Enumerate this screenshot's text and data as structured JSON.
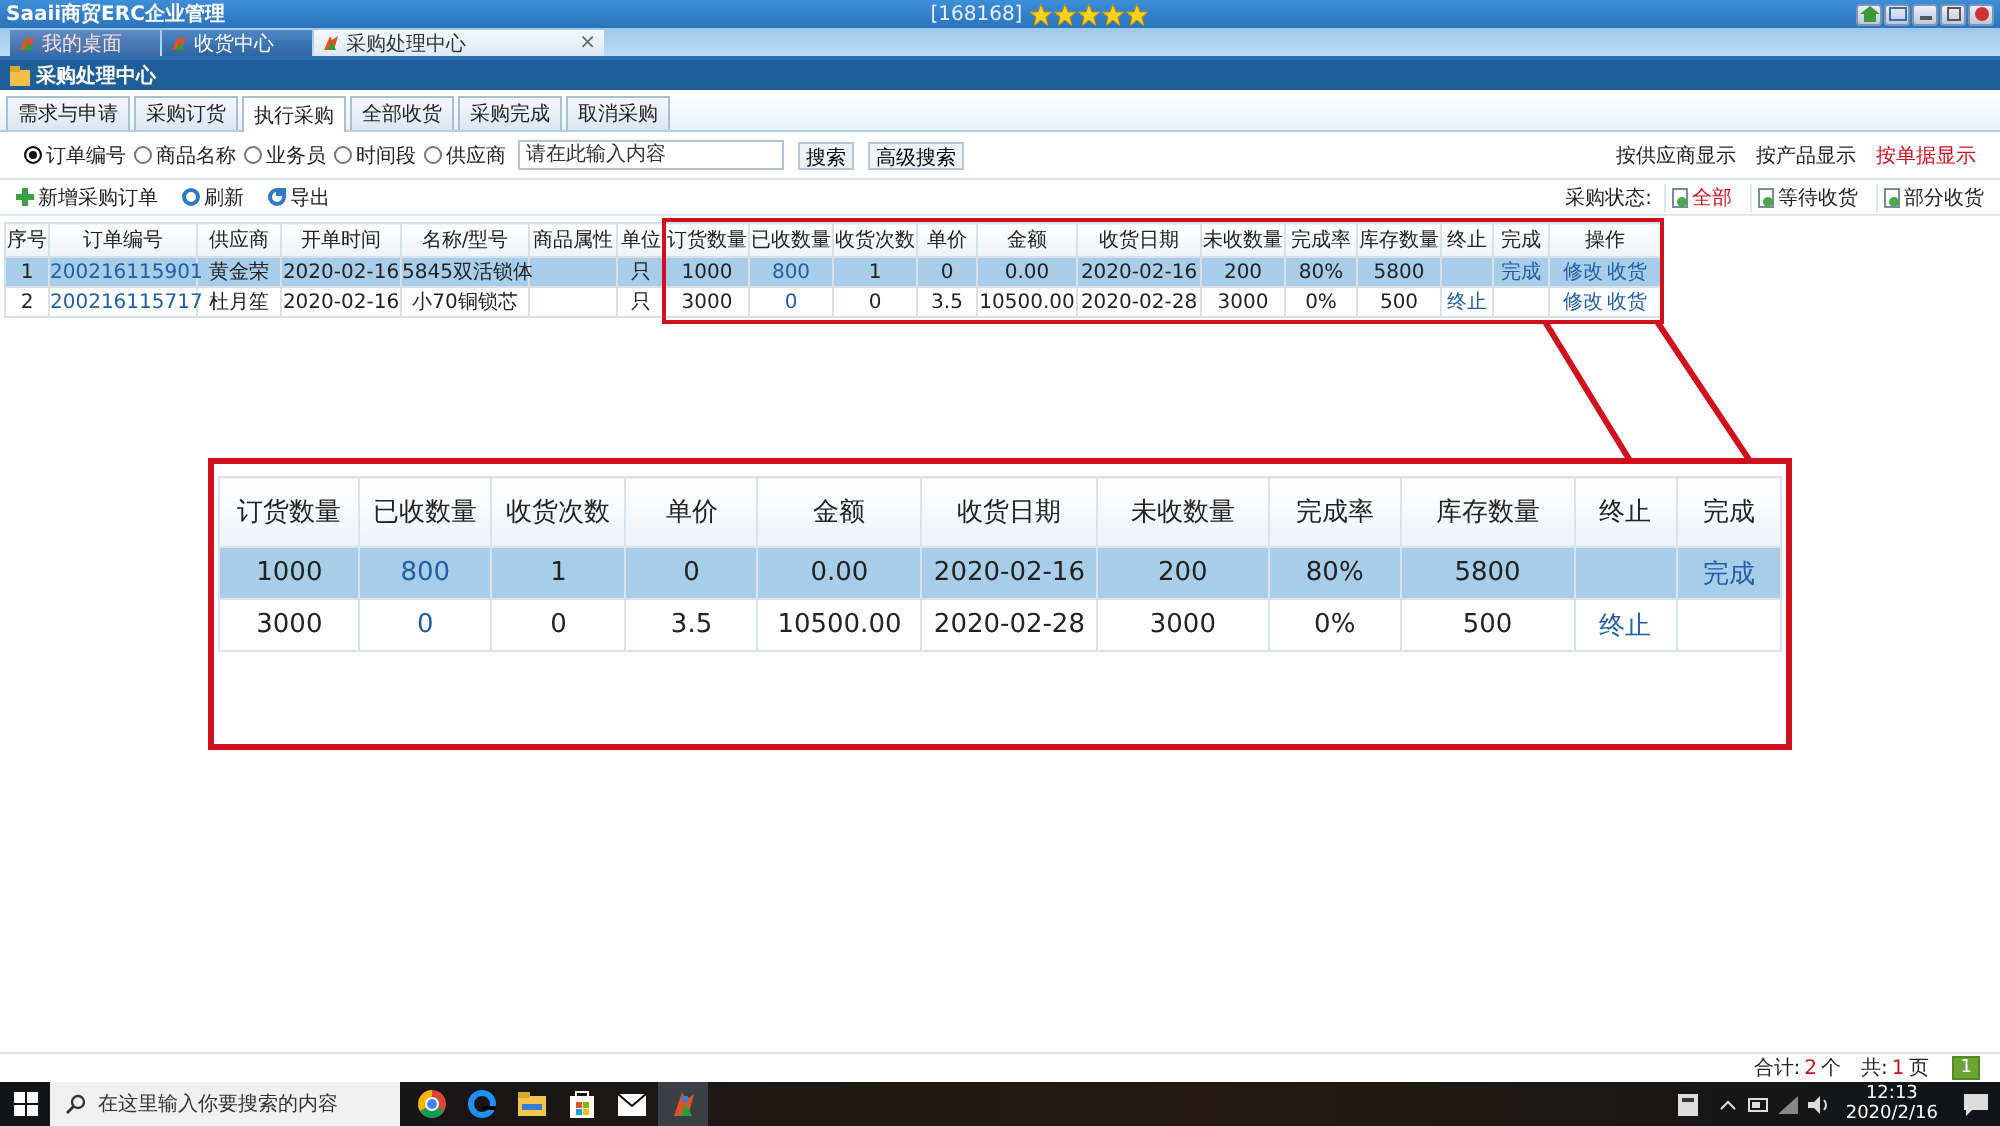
{
  "window": {
    "title": "Saaii商贸ERC企业管理",
    "user": "[168168]"
  },
  "doc_tabs": [
    {
      "label": "我的桌面",
      "selected": false,
      "kind": "home"
    },
    {
      "label": "收货中心",
      "selected": false,
      "kind": "page"
    },
    {
      "label": "采购处理中心",
      "selected": true,
      "kind": "page",
      "close": "×"
    }
  ],
  "page_title": "采购处理中心",
  "tabs": [
    {
      "label": "需求与申请",
      "selected": false
    },
    {
      "label": "采购订货",
      "selected": false
    },
    {
      "label": "执行采购",
      "selected": true
    },
    {
      "label": "全部收货",
      "selected": false
    },
    {
      "label": "采购完成",
      "selected": false
    },
    {
      "label": "取消采购",
      "selected": false
    }
  ],
  "search": {
    "options": [
      {
        "label": "订单编号",
        "selected": true
      },
      {
        "label": "商品名称",
        "selected": false
      },
      {
        "label": "业务员",
        "selected": false
      },
      {
        "label": "时间段",
        "selected": false
      },
      {
        "label": "供应商",
        "selected": false
      }
    ],
    "placeholder": "请在此输入内容",
    "buttons": [
      "搜索",
      "高级搜索"
    ]
  },
  "view_links": [
    {
      "label": "按供应商显示",
      "selected": false
    },
    {
      "label": "按产品显示",
      "selected": false
    },
    {
      "label": "按单据显示",
      "selected": true
    }
  ],
  "toolbar": [
    {
      "label": "新增采购订单",
      "kind": "add"
    },
    {
      "label": "刷新",
      "kind": "refresh"
    },
    {
      "label": "导出",
      "kind": "export"
    }
  ],
  "status_filter": {
    "label": "采购状态:",
    "options": [
      {
        "label": "全部",
        "selected": true
      },
      {
        "label": "等待收货",
        "selected": false
      },
      {
        "label": "部分收货",
        "selected": false
      }
    ]
  },
  "table": {
    "columns": [
      "序号",
      "订单编号",
      "供应商",
      "开单时间",
      "名称/型号",
      "商品属性",
      "单位",
      "订货数量",
      "已收数量",
      "收货次数",
      "单价",
      "金额",
      "收货日期",
      "未收数量",
      "完成率",
      "库存数量",
      "终止",
      "完成",
      "操作"
    ],
    "rows": [
      {
        "selected": true,
        "no": "1",
        "order_no": "200216115901",
        "supplier": "黄金荣",
        "date": "2020-02-16",
        "name": "5845双活锁体",
        "unit": "只",
        "qty": "1000",
        "received": "800",
        "receipts": "1",
        "price": "0",
        "amount": "0.00",
        "recv_date": "2020-02-16",
        "remaining": "200",
        "rate": "80%",
        "stock": "5800",
        "done": "完成",
        "actions": [
          "修改",
          "收货"
        ]
      },
      {
        "selected": false,
        "no": "2",
        "order_no": "200216115717",
        "supplier": "杜月笙",
        "date": "2020-02-16",
        "name": "小70铜锁芯",
        "unit": "只",
        "qty": "3000",
        "received": "0",
        "receipts": "0",
        "price": "3.5",
        "amount": "10500.00",
        "recv_date": "2020-02-28",
        "remaining": "3000",
        "rate": "0%",
        "stock": "500",
        "stop": "终止",
        "actions": [
          "修改",
          "收货"
        ]
      }
    ]
  },
  "callout": {
    "columns": [
      "订货数量",
      "已收数量",
      "收货次数",
      "单价",
      "金额",
      "收货日期",
      "未收数量",
      "完成率",
      "库存数量",
      "终止",
      "完成"
    ],
    "rows": [
      {
        "selected": true,
        "qty": "1000",
        "received": "800",
        "receipts": "1",
        "price": "0",
        "amount": "0.00",
        "recv_date": "2020-02-16",
        "remaining": "200",
        "rate": "80%",
        "stock": "5800",
        "done": "完成"
      },
      {
        "selected": false,
        "qty": "3000",
        "received": "0",
        "receipts": "0",
        "price": "3.5",
        "amount": "10500.00",
        "recv_date": "2020-02-28",
        "remaining": "3000",
        "rate": "0%",
        "stock": "500",
        "stop": "终止"
      }
    ]
  },
  "pager": {
    "total_label": "合计:",
    "total": "2",
    "total_unit": "个",
    "pages_label": "共:",
    "pages": "1",
    "pages_unit": "页",
    "current": "1"
  },
  "taskbar": {
    "search_placeholder": "在这里输入你要搜索的内容",
    "time": "12:13",
    "date": "2020/2/16"
  }
}
